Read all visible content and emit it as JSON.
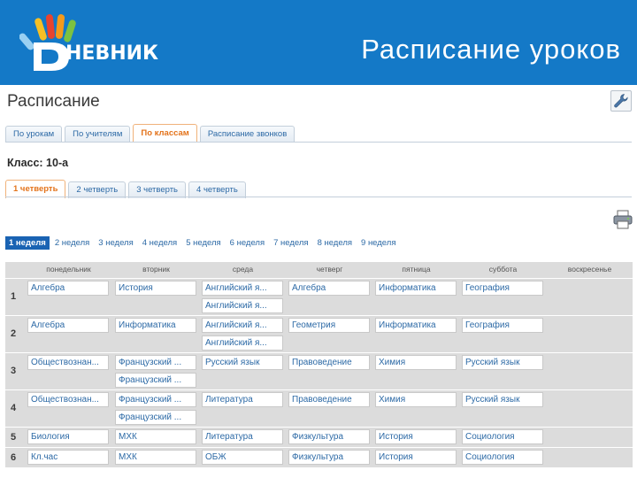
{
  "header": {
    "logo_text": "НЕВНИК",
    "title": "Расписание уроков"
  },
  "page": {
    "title": "Расписание"
  },
  "top_tabs": [
    {
      "label": "По урокам",
      "active": false
    },
    {
      "label": "По учителям",
      "active": false
    },
    {
      "label": "По классам",
      "active": true
    },
    {
      "label": "Расписание звонков",
      "active": false
    }
  ],
  "class_label": "Класс: 10-а",
  "quarter_tabs": [
    {
      "label": "1 четверть",
      "active": true
    },
    {
      "label": "2 четверть",
      "active": false
    },
    {
      "label": "3 четверть",
      "active": false
    },
    {
      "label": "4 четверть",
      "active": false
    }
  ],
  "weeks": [
    {
      "label": "1 неделя",
      "active": true
    },
    {
      "label": "2 неделя",
      "active": false
    },
    {
      "label": "3 неделя",
      "active": false
    },
    {
      "label": "4 неделя",
      "active": false
    },
    {
      "label": "5 неделя",
      "active": false
    },
    {
      "label": "6 неделя",
      "active": false
    },
    {
      "label": "7 неделя",
      "active": false
    },
    {
      "label": "8 неделя",
      "active": false
    },
    {
      "label": "9 неделя",
      "active": false
    }
  ],
  "days": [
    "понедельник",
    "вторник",
    "среда",
    "четверг",
    "пятница",
    "суббота",
    "воскресенье"
  ],
  "lessons": [
    {
      "num": "1",
      "cells": [
        [
          "Алгебра"
        ],
        [
          "История"
        ],
        [
          "Английский я...",
          "Английский я..."
        ],
        [
          "Алгебра"
        ],
        [
          "Информатика"
        ],
        [
          "География"
        ],
        []
      ]
    },
    {
      "num": "2",
      "cells": [
        [
          "Алгебра"
        ],
        [
          "Информатика"
        ],
        [
          "Английский я...",
          "Английский я..."
        ],
        [
          "Геометрия"
        ],
        [
          "Информатика"
        ],
        [
          "География"
        ],
        []
      ]
    },
    {
      "num": "3",
      "cells": [
        [
          "Обществознан..."
        ],
        [
          "Французский ...",
          "Французский ..."
        ],
        [
          "Русский язык"
        ],
        [
          "Правоведение"
        ],
        [
          "Химия"
        ],
        [
          "Русский язык"
        ],
        []
      ]
    },
    {
      "num": "4",
      "cells": [
        [
          "Обществознан..."
        ],
        [
          "Французский ...",
          "Французский ..."
        ],
        [
          "Литература"
        ],
        [
          "Правоведение"
        ],
        [
          "Химия"
        ],
        [
          "Русский язык"
        ],
        []
      ]
    },
    {
      "num": "5",
      "cells": [
        [
          "Биология"
        ],
        [
          "МХК"
        ],
        [
          "Литература"
        ],
        [
          "Физкультура"
        ],
        [
          "История"
        ],
        [
          "Социология"
        ],
        []
      ]
    },
    {
      "num": "6",
      "cells": [
        [
          "Кл.час"
        ],
        [
          "МХК"
        ],
        [
          "ОБЖ"
        ],
        [
          "Физкультура"
        ],
        [
          "История"
        ],
        [
          "Социология"
        ],
        []
      ]
    }
  ],
  "icons": {
    "settings": "wrench-icon",
    "print": "printer-icon"
  },
  "colors": {
    "header_bg": "#1479c7",
    "active_tab": "#e3731b",
    "link": "#2d6aa6",
    "active_week": "#1a63b3"
  }
}
